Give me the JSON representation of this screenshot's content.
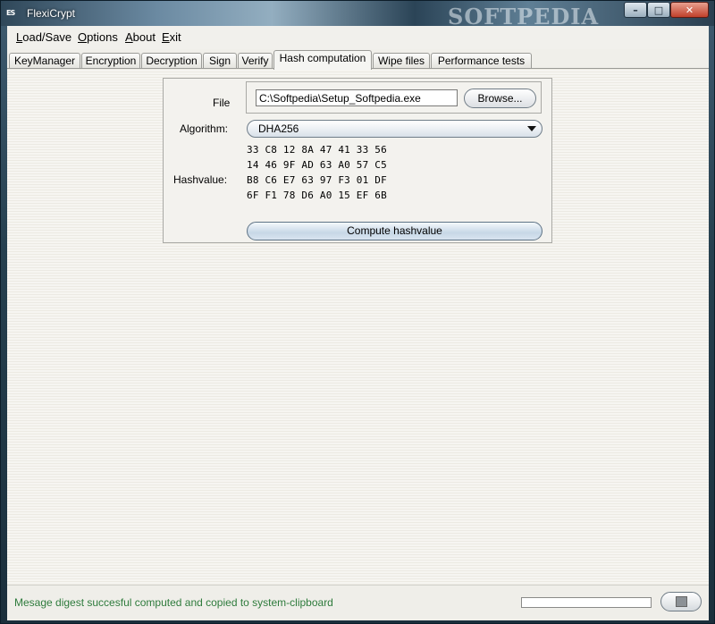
{
  "window": {
    "title": "FlexiCrypt",
    "icon_text": "ES",
    "brand_watermark": "SOFTPEDIA",
    "controls": {
      "minimize": "–",
      "maximize": "□",
      "close": "✕"
    }
  },
  "menubar": {
    "items": [
      {
        "label": "Load/Save",
        "mnemonic": "L",
        "rest": "oad/Save"
      },
      {
        "label": "Options",
        "mnemonic": "O",
        "rest": "ptions"
      },
      {
        "label": "About",
        "mnemonic": "A",
        "rest": "bout"
      },
      {
        "label": "Exit",
        "mnemonic": "E",
        "rest": "xit"
      }
    ]
  },
  "tabs": [
    "KeyManager",
    "Encryption",
    "Decryption",
    "Sign",
    "Verify",
    "Hash computation",
    "Wipe files",
    "Performance tests"
  ],
  "active_tab": "Hash computation",
  "hash_panel": {
    "file_label": "File",
    "file_value": "C:\\Softpedia\\Setup_Softpedia.exe",
    "browse_label": "Browse...",
    "algorithm_label": "Algorithm:",
    "algorithm_value": "DHA256",
    "hashvalue_label": "Hashvalue:",
    "hash_lines": [
      "33 C8 12 8A 47 41 33 56",
      "14 46 9F AD 63 A0 57 C5",
      "B8 C6 E7 63 97 F3 01 DF",
      "6F F1 78 D6 A0 15 EF 6B"
    ],
    "compute_label": "Compute hashvalue"
  },
  "statusbar": {
    "message": "Mesage digest succesful computed and copied to system-clipboard",
    "progress": 0
  },
  "icons": {
    "stop": "stop-icon",
    "dropdown": "chevron-down-icon"
  },
  "colors": {
    "status_text": "#2e7b3c",
    "accent": "#c7d7e6"
  }
}
